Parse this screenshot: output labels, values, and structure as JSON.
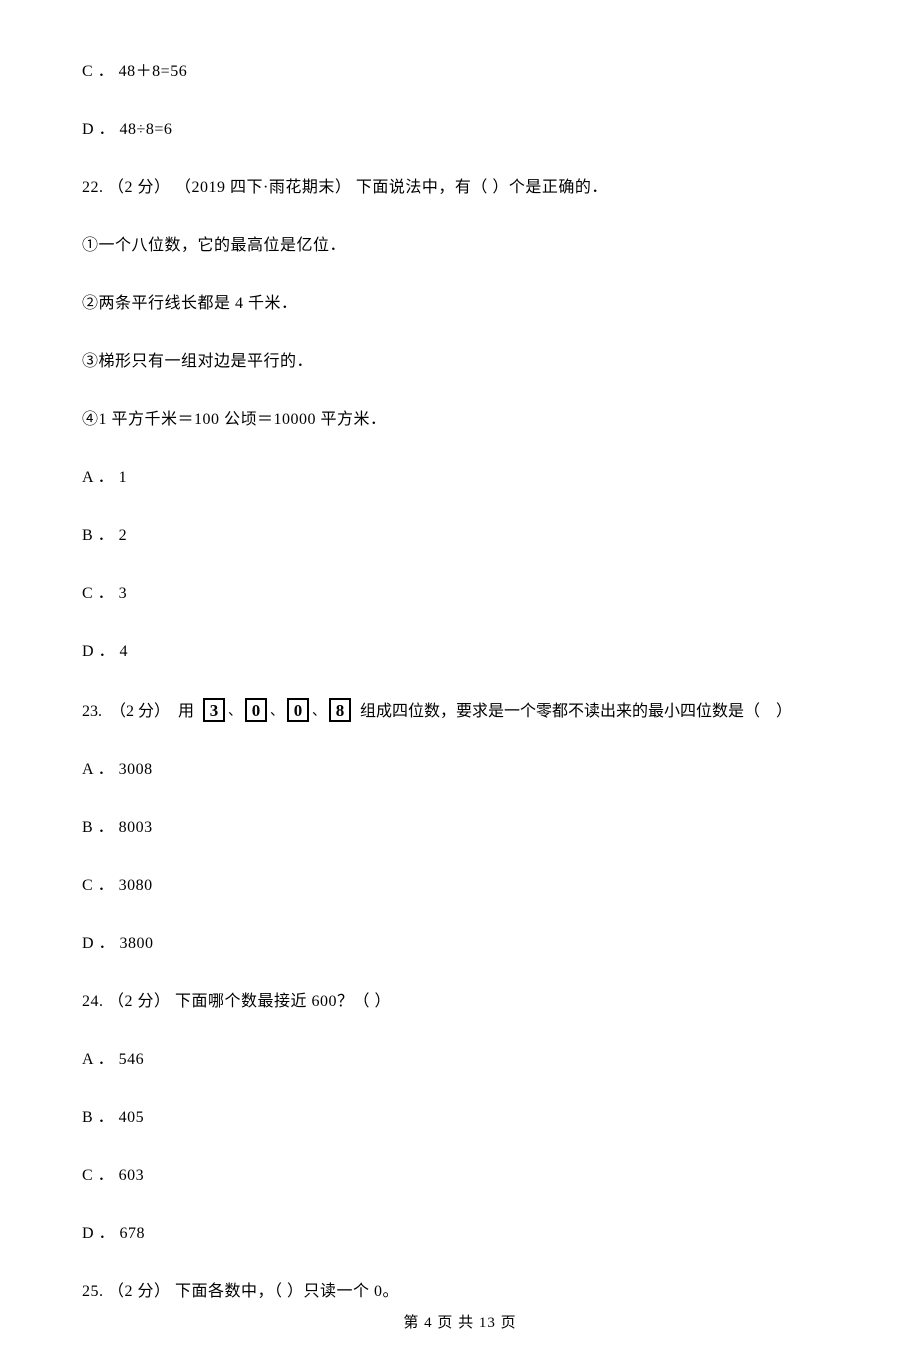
{
  "q21": {
    "optC": "C ． 48＋8=56",
    "optD": "D ． 48÷8=6"
  },
  "q22": {
    "stem": "22.  （2 分） （2019 四下·雨花期末） 下面说法中，有（    ）个是正确的．",
    "s1": "①一个八位数，它的最高位是亿位．",
    "s2": "②两条平行线长都是 4 千米．",
    "s3": "③梯形只有一组对边是平行的．",
    "s4": "④1 平方千米＝100 公顷＝10000 平方米．",
    "optA": "A ． 1",
    "optB": "B ． 2",
    "optC": "C ． 3",
    "optD": "D ． 4"
  },
  "q23": {
    "pre": "23.  （2 分）  用  ",
    "cards": [
      "3",
      "0",
      "0",
      "8"
    ],
    "sep": "、",
    "post": "  组成四位数，要求是一个零都不读出来的最小四位数是（    ）",
    "optA": "A ． 3008",
    "optB": "B ． 8003",
    "optC": "C ． 3080",
    "optD": "D ． 3800"
  },
  "q24": {
    "stem": "24.  （2 分）  下面哪个数最接近 600？（    ）",
    "optA": "A ． 546",
    "optB": "B ． 405",
    "optC": "C ． 603",
    "optD": "D ． 678"
  },
  "q25": {
    "stem": "25.  （2 分）  下面各数中，（    ）只读一个 0。"
  },
  "footer": "第 4 页 共 13 页"
}
